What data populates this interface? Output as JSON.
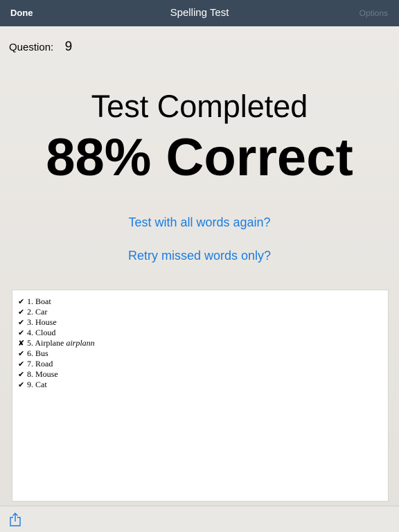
{
  "navbar": {
    "done_label": "Done",
    "title": "Spelling Test",
    "options_label": "Options"
  },
  "question": {
    "label": "Question:",
    "number": "9"
  },
  "result": {
    "headline": "Test Completed",
    "score": "88% Correct"
  },
  "links": {
    "test_all": "Test with all words again?",
    "retry_missed": "Retry missed words only?"
  },
  "results_list": [
    {
      "mark": "✔",
      "text": "1. Boat",
      "misspelled": ""
    },
    {
      "mark": "✔",
      "text": "2. Car",
      "misspelled": ""
    },
    {
      "mark": "✔",
      "text": "3. House",
      "misspelled": ""
    },
    {
      "mark": "✔",
      "text": "4. Cloud",
      "misspelled": ""
    },
    {
      "mark": "✘",
      "text": "5. Airplane",
      "misspelled": "airplann"
    },
    {
      "mark": "✔",
      "text": "6. Bus",
      "misspelled": ""
    },
    {
      "mark": "✔",
      "text": "7. Road",
      "misspelled": ""
    },
    {
      "mark": "✔",
      "text": "8. Mouse",
      "misspelled": ""
    },
    {
      "mark": "✔",
      "text": "9. Cat",
      "misspelled": ""
    }
  ],
  "toolbar": {
    "share_icon": "share-icon"
  },
  "colors": {
    "navbar_bg": "#3b4a5a",
    "link": "#1a7ce0",
    "disabled_text": "#6d7a88"
  }
}
